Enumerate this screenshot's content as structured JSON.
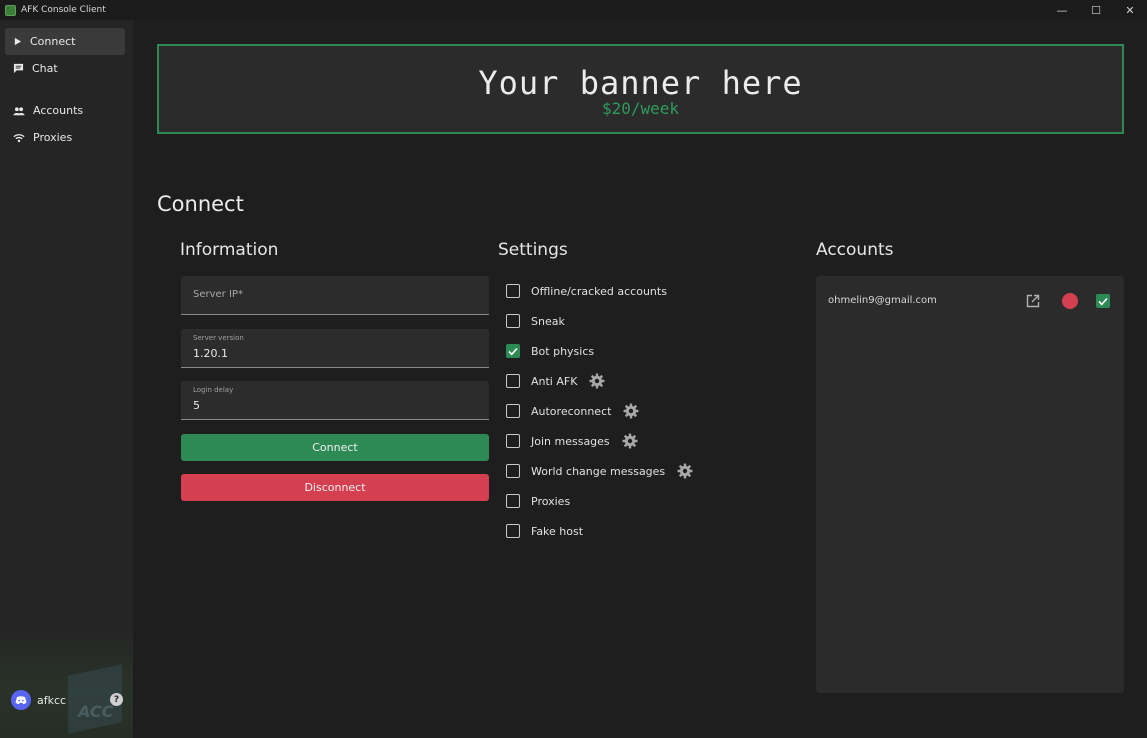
{
  "window": {
    "title": "AFK Console Client",
    "minimize": "—",
    "maximize": "☐",
    "close": "✕"
  },
  "sidebar": {
    "items": [
      {
        "label": "Connect",
        "icon": "play-icon",
        "active": true
      },
      {
        "label": "Chat",
        "icon": "chat-icon",
        "active": false
      },
      {
        "label": "Accounts",
        "icon": "users-icon",
        "active": false
      },
      {
        "label": "Proxies",
        "icon": "wifi-icon",
        "active": false
      }
    ],
    "user": {
      "name": "afkcc",
      "help": "?"
    },
    "art_text": "ACC"
  },
  "banner": {
    "title": "Your banner here",
    "subtitle": "$20/week"
  },
  "page": {
    "title": "Connect"
  },
  "information": {
    "title": "Information",
    "server_ip_placeholder": "Server IP*",
    "server_version_label": "Server version",
    "server_version_value": "1.20.1",
    "login_delay_label": "Login delay",
    "login_delay_value": "5",
    "connect_label": "Connect",
    "disconnect_label": "Disconnect"
  },
  "settings": {
    "title": "Settings",
    "items": [
      {
        "label": "Offline/cracked accounts",
        "checked": false,
        "gear": false
      },
      {
        "label": "Sneak",
        "checked": false,
        "gear": false
      },
      {
        "label": "Bot physics",
        "checked": true,
        "gear": false
      },
      {
        "label": "Anti AFK",
        "checked": false,
        "gear": true
      },
      {
        "label": "Autoreconnect",
        "checked": false,
        "gear": true
      },
      {
        "label": "Join messages",
        "checked": false,
        "gear": true
      },
      {
        "label": "World change messages",
        "checked": false,
        "gear": true
      },
      {
        "label": "Proxies",
        "checked": false,
        "gear": false
      },
      {
        "label": "Fake host",
        "checked": false,
        "gear": false
      }
    ]
  },
  "accounts": {
    "title": "Accounts",
    "items": [
      {
        "email": "ohmelin9@gmail.com",
        "status_color": "#d54050",
        "selected": true
      }
    ]
  },
  "colors": {
    "accent_green": "#2e8a55",
    "danger_red": "#d54050",
    "background": "#1e1e1e",
    "sidebar": "#252525",
    "panel": "#2b2b2b"
  }
}
